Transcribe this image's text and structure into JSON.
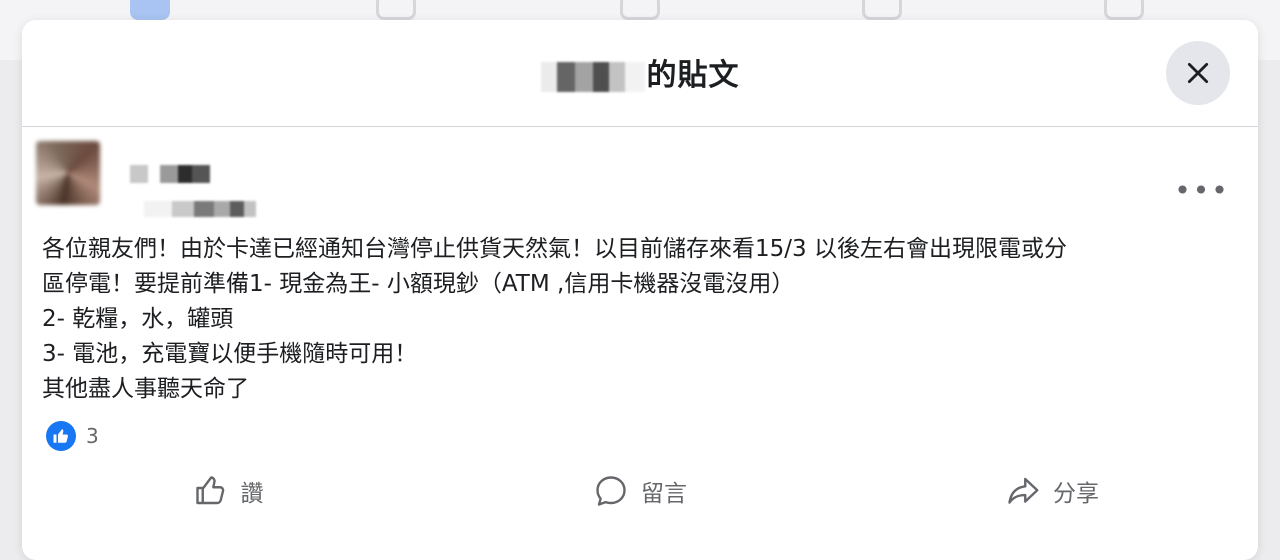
{
  "dialog": {
    "title_suffix": "的貼文",
    "close_label": "×"
  },
  "post": {
    "more_label": "•••",
    "lines": [
      "各位親友們！由於卡達已經通知台灣停止供貨天然氣！以目前儲存來看15/3 以後左右會出現限電或分",
      "區停電！要提前準備1- 現金為王- 小額現鈔（ATM ,信用卡機器沒電沒用）",
      "2- 乾糧，水，罐頭",
      "3- 電池，充電寶以便手機隨時可用！",
      "其他盡人事聽天命了"
    ],
    "reaction_count": "3"
  },
  "actions": {
    "like": "讚",
    "comment": "留言",
    "share": "分享"
  },
  "colors": {
    "accent": "#1877f2",
    "text": "#1c1e21",
    "secondary": "#65676b",
    "divider": "#d5d6d9"
  }
}
